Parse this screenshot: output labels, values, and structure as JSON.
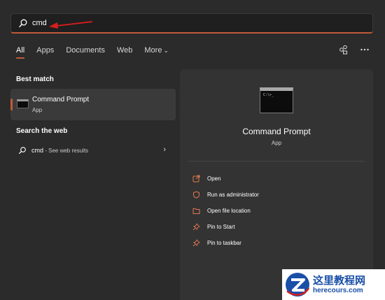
{
  "search": {
    "value": "cmd",
    "placeholder": ""
  },
  "tabs": [
    {
      "label": "All",
      "active": true
    },
    {
      "label": "Apps"
    },
    {
      "label": "Documents"
    },
    {
      "label": "Web"
    },
    {
      "label": "More",
      "has_dropdown": true
    }
  ],
  "top_icons": [
    "share-icon",
    "more-options-icon"
  ],
  "best_match": {
    "heading": "Best match",
    "name": "Command Prompt",
    "type": "App"
  },
  "web_search": {
    "heading": "Search the web",
    "query": "cmd",
    "suffix": " - See web results"
  },
  "detail": {
    "title": "Command Prompt",
    "subtitle": "App",
    "icon_text": "C:\\>_",
    "actions": [
      {
        "label": "Open",
        "icon": "open-icon"
      },
      {
        "label": "Run as administrator",
        "icon": "shield-icon"
      },
      {
        "label": "Open file location",
        "icon": "folder-icon"
      },
      {
        "label": "Pin to Start",
        "icon": "pin-icon"
      },
      {
        "label": "Pin to taskbar",
        "icon": "pin-icon"
      }
    ]
  },
  "watermark": {
    "name": "这里教程网",
    "url": "herecours.com"
  },
  "colors": {
    "accent": "#c15a3a",
    "background": "#2b2b2b",
    "panel": "#333333",
    "annotation_arrow": "#d81e1e",
    "watermark_text": "#1a4fa8"
  }
}
